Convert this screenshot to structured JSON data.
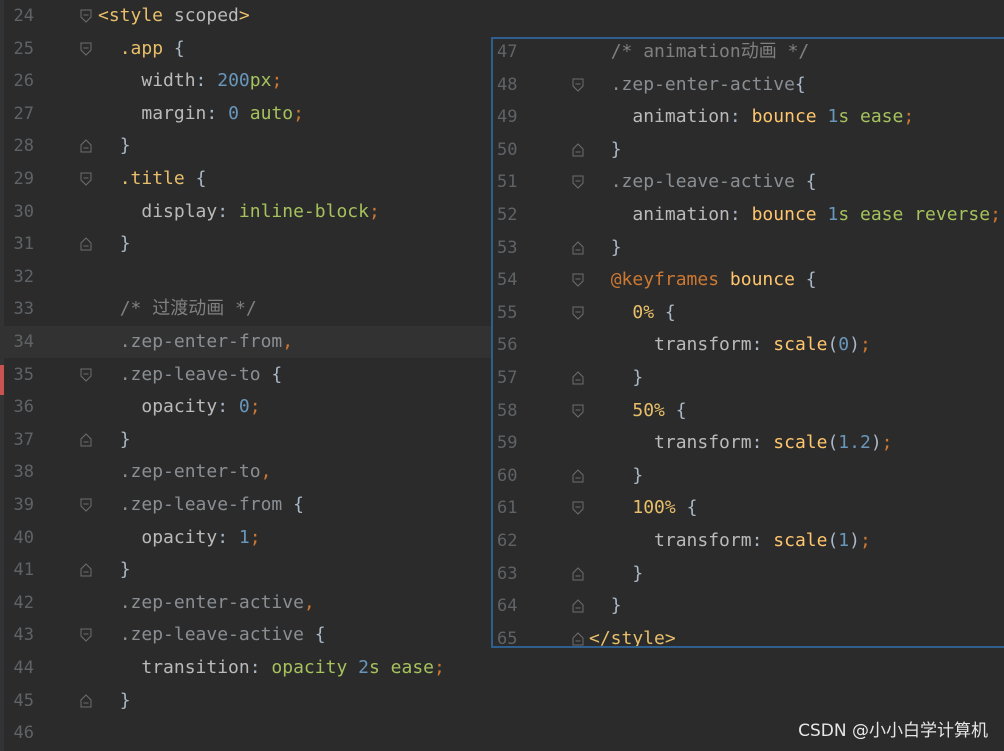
{
  "main_lines": [
    {
      "n": "24",
      "html": "<span class=\"tag\">&lt;style</span> <span class=\"attr\">scoped</span><span class=\"tag\">&gt;</span>",
      "fold": "open"
    },
    {
      "n": "25",
      "html": "  <span class=\"sel\">.app</span> <span class=\"brace\">{</span>",
      "fold": "open"
    },
    {
      "n": "26",
      "html": "    <span class=\"prop\">width</span>: <span class=\"num\">200</span><span class=\"val\">px</span><span class=\"punc\">;</span>",
      "fold": ""
    },
    {
      "n": "27",
      "html": "    <span class=\"prop\">margin</span>: <span class=\"num\">0</span> <span class=\"val\">auto</span><span class=\"punc\">;</span>",
      "fold": ""
    },
    {
      "n": "28",
      "html": "  <span class=\"brace\">}</span>",
      "fold": "close"
    },
    {
      "n": "29",
      "html": "  <span class=\"sel\">.title</span> <span class=\"brace\">{</span>",
      "fold": "open"
    },
    {
      "n": "30",
      "html": "    <span class=\"prop\">display</span>: <span class=\"val\">inline-block</span><span class=\"punc\">;</span>",
      "fold": ""
    },
    {
      "n": "31",
      "html": "  <span class=\"brace\">}</span>",
      "fold": "close"
    },
    {
      "n": "32",
      "html": "",
      "fold": ""
    },
    {
      "n": "33",
      "html": "  <span class=\"cmt\">/* 过渡动画 */</span>",
      "fold": ""
    },
    {
      "n": "34",
      "html": "  <span class=\"sel-dim\">.zep-enter-from</span><span class=\"punc\">,</span>",
      "fold": "",
      "current": true
    },
    {
      "n": "35",
      "html": "  <span class=\"sel-dim\">.zep-leave-to</span> <span class=\"brace\">{</span>",
      "fold": "open"
    },
    {
      "n": "36",
      "html": "    <span class=\"prop\">opacity</span>: <span class=\"num\">0</span><span class=\"punc\">;</span>",
      "fold": ""
    },
    {
      "n": "37",
      "html": "  <span class=\"brace\">}</span>",
      "fold": "close"
    },
    {
      "n": "38",
      "html": "  <span class=\"sel-dim\">.zep-enter-to</span><span class=\"punc\">,</span>",
      "fold": ""
    },
    {
      "n": "39",
      "html": "  <span class=\"sel-dim\">.zep-leave-from</span> <span class=\"brace\">{</span>",
      "fold": "open"
    },
    {
      "n": "40",
      "html": "    <span class=\"prop\">opacity</span>: <span class=\"num\">1</span><span class=\"punc\">;</span>",
      "fold": ""
    },
    {
      "n": "41",
      "html": "  <span class=\"brace\">}</span>",
      "fold": "close"
    },
    {
      "n": "42",
      "html": "  <span class=\"sel-dim\">.zep-enter-active</span><span class=\"punc\">,</span>",
      "fold": ""
    },
    {
      "n": "43",
      "html": "  <span class=\"sel-dim\">.zep-leave-active</span> <span class=\"brace\">{</span>",
      "fold": "open"
    },
    {
      "n": "44",
      "html": "    <span class=\"prop\">transition</span>: <span class=\"val\">opacity</span> <span class=\"num\">2</span><span class=\"val\">s</span> <span class=\"val\">ease</span><span class=\"punc\">;</span>",
      "fold": ""
    },
    {
      "n": "45",
      "html": "  <span class=\"brace\">}</span>",
      "fold": "close"
    },
    {
      "n": "46",
      "html": "",
      "fold": ""
    }
  ],
  "popup_lines": [
    {
      "n": "47",
      "html": "  <span class=\"cmt\">/* animation动画 */</span>",
      "fold": ""
    },
    {
      "n": "48",
      "html": "  <span class=\"sel-dim\">.zep-enter-active</span><span class=\"brace\">{</span>",
      "fold": "open"
    },
    {
      "n": "49",
      "html": "    <span class=\"prop\">animation</span>: <span class=\"fn\">bounce</span> <span class=\"num\">1</span><span class=\"val\">s</span> <span class=\"val\">ease</span><span class=\"punc\">;</span>",
      "fold": ""
    },
    {
      "n": "50",
      "html": "  <span class=\"brace\">}</span>",
      "fold": "close"
    },
    {
      "n": "51",
      "html": "  <span class=\"sel-dim\">.zep-leave-active</span> <span class=\"brace\">{</span>",
      "fold": "open"
    },
    {
      "n": "52",
      "html": "    <span class=\"prop\">animation</span>: <span class=\"fn\">bounce</span> <span class=\"num\">1</span><span class=\"val\">s</span> <span class=\"val\">ease</span> <span class=\"val\">reverse</span><span class=\"punc\">;</span>",
      "fold": ""
    },
    {
      "n": "53",
      "html": "  <span class=\"brace\">}</span>",
      "fold": "close"
    },
    {
      "n": "54",
      "html": "  <span class=\"kw\">@keyframes</span> <span class=\"fn\">bounce</span> <span class=\"brace\">{</span>",
      "fold": "open"
    },
    {
      "n": "55",
      "html": "    <span class=\"pct\">0%</span> <span class=\"brace\">{</span>",
      "fold": "open"
    },
    {
      "n": "56",
      "html": "      <span class=\"prop\">transform</span>: <span class=\"fn\">scale</span>(<span class=\"num\">0</span>)<span class=\"punc\">;</span>",
      "fold": ""
    },
    {
      "n": "57",
      "html": "    <span class=\"brace\">}</span>",
      "fold": "close"
    },
    {
      "n": "58",
      "html": "    <span class=\"pct\">50%</span> <span class=\"brace\">{</span>",
      "fold": "open"
    },
    {
      "n": "59",
      "html": "      <span class=\"prop\">transform</span>: <span class=\"fn\">scale</span>(<span class=\"num\">1.2</span>)<span class=\"punc\">;</span>",
      "fold": ""
    },
    {
      "n": "60",
      "html": "    <span class=\"brace\">}</span>",
      "fold": "close"
    },
    {
      "n": "61",
      "html": "    <span class=\"pct\">100%</span> <span class=\"brace\">{</span>",
      "fold": "open"
    },
    {
      "n": "62",
      "html": "      <span class=\"prop\">transform</span>: <span class=\"fn\">scale</span>(<span class=\"num\">1</span>)<span class=\"punc\">;</span>",
      "fold": ""
    },
    {
      "n": "63",
      "html": "    <span class=\"brace\">}</span>",
      "fold": "close"
    },
    {
      "n": "64",
      "html": "  <span class=\"brace\">}</span>",
      "fold": "close"
    },
    {
      "n": "65",
      "html": "<span class=\"tag\">&lt;/style&gt;</span>",
      "fold": "close"
    }
  ],
  "watermark": "CSDN @小小白学计算机",
  "colors": {
    "background": "#2b2b2b",
    "line_number": "#606366",
    "popup_border": "#2f5f8f",
    "current_line": "#323232"
  }
}
